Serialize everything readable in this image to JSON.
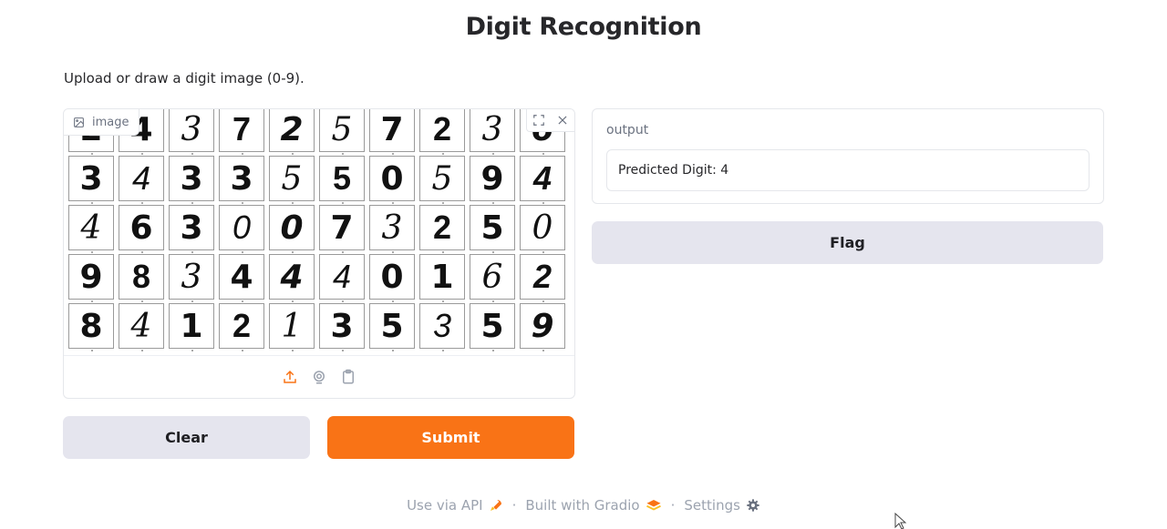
{
  "title": "Digit Recognition",
  "description": "Upload or draw a digit image (0-9).",
  "image_input": {
    "label": "image",
    "digits": [
      [
        "2",
        "4",
        "3",
        "7",
        "2",
        "5",
        "7",
        "2",
        "3",
        "6"
      ],
      [
        "3",
        "4",
        "3",
        "3",
        "5",
        "5",
        "0",
        "5",
        "9",
        "4"
      ],
      [
        "4",
        "6",
        "3",
        "0",
        "0",
        "7",
        "3",
        "2",
        "5",
        "0"
      ],
      [
        "9",
        "8",
        "3",
        "4",
        "4",
        "4",
        "0",
        "1",
        "6",
        "2"
      ],
      [
        "8",
        "4",
        "1",
        "2",
        "1",
        "3",
        "5",
        "3",
        "5",
        "9"
      ]
    ],
    "source_icons": [
      "upload-icon",
      "webcam-icon",
      "clipboard-icon"
    ]
  },
  "buttons": {
    "clear": "Clear",
    "submit": "Submit",
    "flag": "Flag"
  },
  "output": {
    "label": "output",
    "value": "Predicted Digit: 4"
  },
  "footer": {
    "api": "Use via API",
    "built": "Built with Gradio",
    "settings": "Settings"
  },
  "colors": {
    "accent": "#f97316",
    "secondary_button": "#e5e5ee"
  }
}
